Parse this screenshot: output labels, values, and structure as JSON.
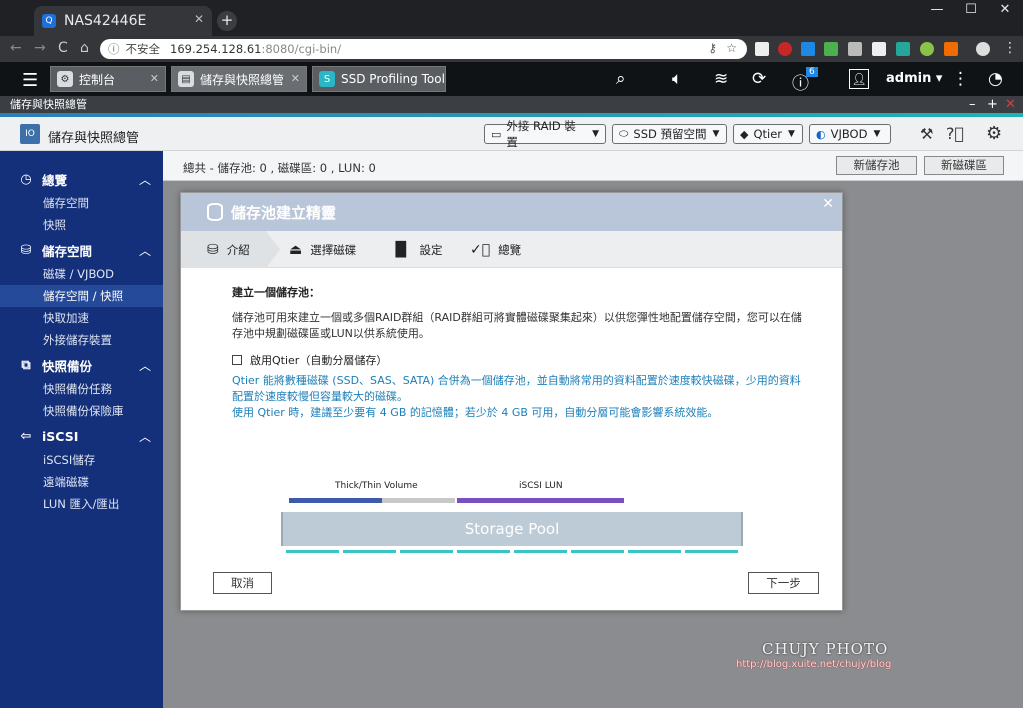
{
  "browser": {
    "tab_title": "NAS42446E",
    "tab_icon": "Q",
    "security": "不安全",
    "url_host": "169.254.128.61",
    "url_path": ":8080/cgi-bin/"
  },
  "qts": {
    "tabs": [
      {
        "label": "控制台"
      },
      {
        "label": "儲存與快照總管"
      },
      {
        "label": "SSD Profiling Tool"
      }
    ],
    "user": "admin",
    "notification_count": "6"
  },
  "app": {
    "window_title": "儲存與快照總管",
    "name": "儲存與快照總管",
    "toolbar": [
      {
        "label": "外接 RAID 裝置"
      },
      {
        "label": "SSD 預留空間"
      },
      {
        "label": "Qtier"
      },
      {
        "label": "VJBOD"
      }
    ]
  },
  "sidebar": {
    "groups": [
      {
        "label": "總覽",
        "items": [
          "儲存空間",
          "快照"
        ]
      },
      {
        "label": "儲存空間",
        "items": [
          "磁碟 / VJBOD",
          "儲存空間 / 快照",
          "快取加速",
          "外接儲存裝置"
        ]
      },
      {
        "label": "快照備份",
        "items": [
          "快照備份任務",
          "快照備份保險庫"
        ]
      },
      {
        "label": "iSCSI",
        "items": [
          "iSCSI儲存",
          "遠端磁碟",
          "LUN 匯入/匯出"
        ]
      }
    ]
  },
  "summary": {
    "text": "總共 - 儲存池: 0 , 磁碟區: 0 , LUN: 0",
    "new_pool": "新儲存池",
    "new_volume": "新磁碟區"
  },
  "dialog": {
    "title": "儲存池建立精靈",
    "steps": [
      "介紹",
      "選擇磁碟",
      "設定",
      "總覽"
    ],
    "heading": "建立一個儲存池：",
    "description": "儲存池可用來建立一個或多個RAID群組（RAID群組可將實體磁碟聚集起來）以供您彈性地配置儲存空間，您可以在儲存池中規劃磁碟區或LUN以供系統使用。",
    "qtier_checkbox": "啟用Qtier（自動分層儲存）",
    "qtier_desc1": "Qtier 能將數種磁碟 (SSD、SAS、SATA) 合併為一個儲存池，並自動將常用的資料配置於速度較快磁碟，少用的資料配置於速度較慢但容量較大的磁碟。",
    "qtier_desc2": "使用 Qtier 時，建議至少要有 4 GB 的記憶體；若少於 4 GB 可用，自動分層可能會影響系統效能。",
    "diagram": {
      "label_volume": "Thick/Thin Volume",
      "label_lun": "iSCSI LUN",
      "pool": "Storage Pool"
    },
    "cancel": "取消",
    "next": "下一步"
  },
  "watermark": {
    "line1": "CHUJY PHOTO",
    "line2": "http://blog.xuite.net/chujy/blog"
  }
}
